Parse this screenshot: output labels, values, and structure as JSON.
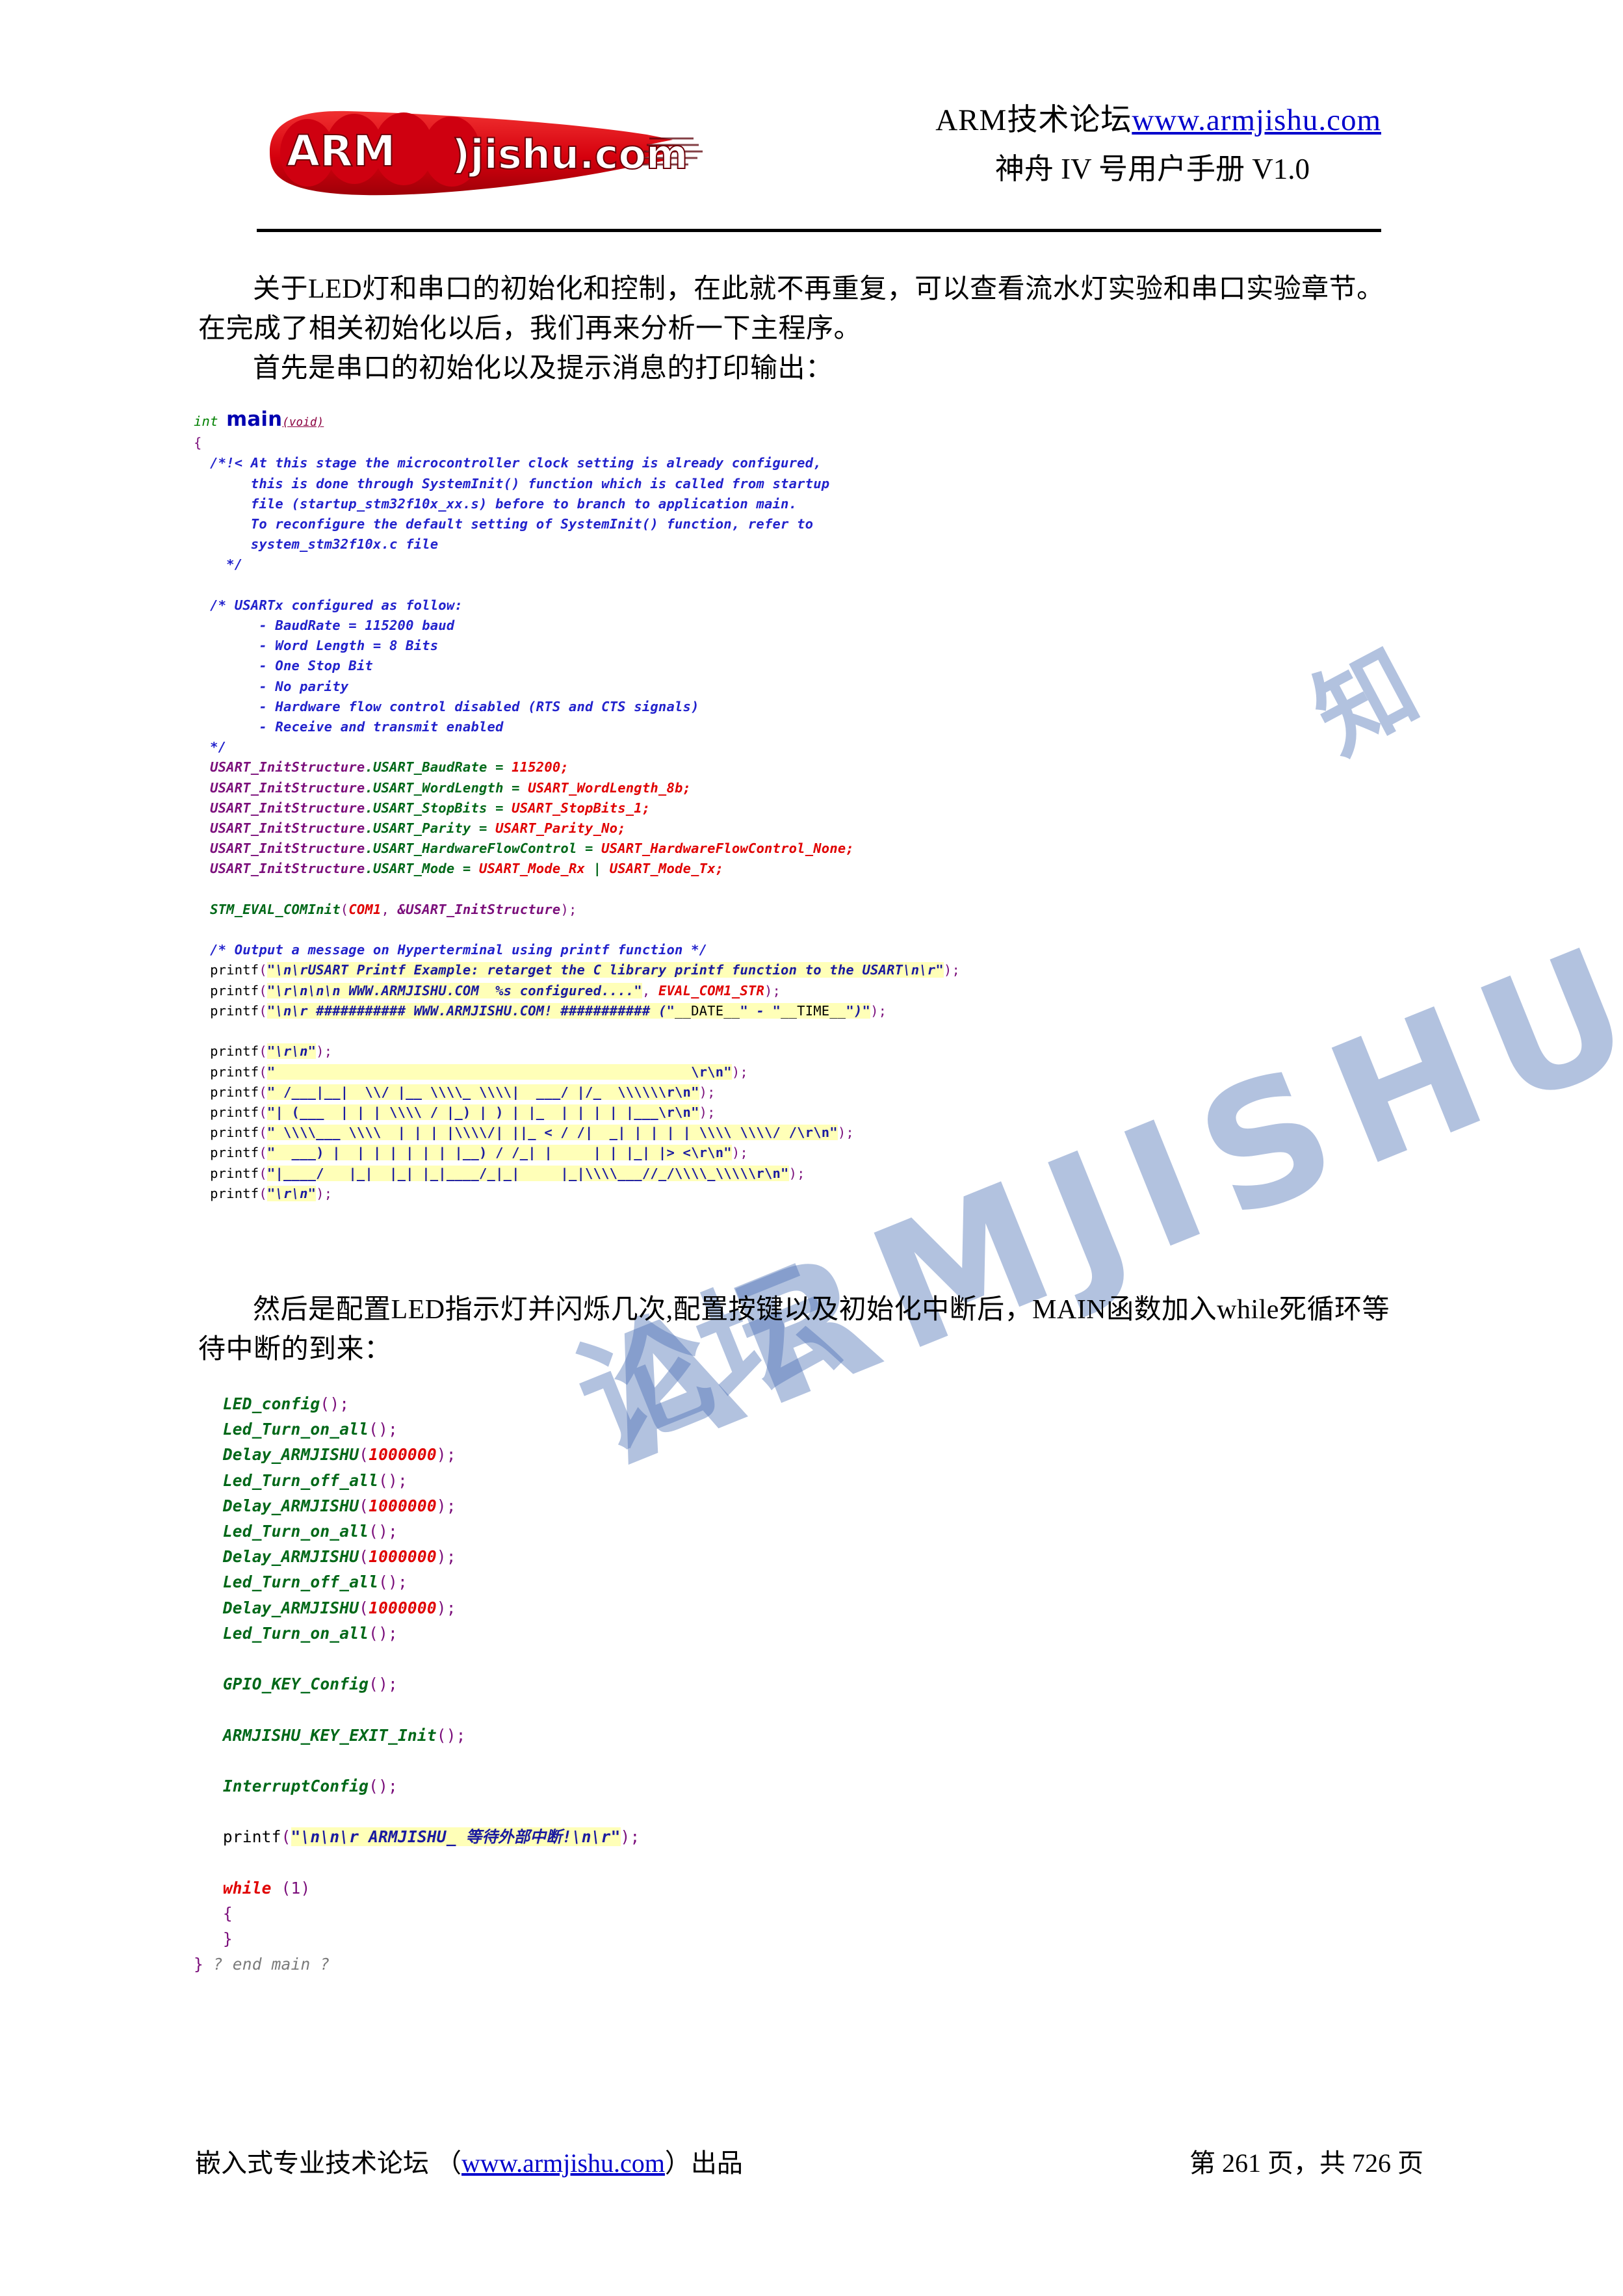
{
  "header": {
    "logo_alt": "ARMjishu.com",
    "logo_text_main": "ARM",
    "logo_text_sub": "jishu.com",
    "line1_cn": "ARM技术论坛",
    "line1_url": "www.armjishu.com",
    "line2": "神舟 IV 号用户手册 V1.0"
  },
  "paragraphs": {
    "p1": "关于LED灯和串口的初始化和控制，在此就不再重复，可以查看流水灯实验和串口实验章节。在完成了相关初始化以后，我们再来分析一下主程序。",
    "p1b": "首先是串口的初始化以及提示消息的打印输出：",
    "p2": "然后是配置LED指示灯并闪烁几次,配置按键以及初始化中断后，MAIN函数加入while死循环等待中断的到来："
  },
  "code1": {
    "signature_type": "int",
    "signature_name": "main",
    "signature_params": "(void)",
    "open_brace": "{",
    "comment1": [
      "/*!< At this stage the microcontroller clock setting is already configured,",
      "     this is done through SystemInit() function which is called from startup",
      "     file (startup_stm32f10x_xx.s) before to branch to application main.",
      "     To reconfigure the default setting of SystemInit() function, refer to",
      "     system_stm32f10x.c file",
      "  */"
    ],
    "comment2": [
      "/* USARTx configured as follow:",
      "      - BaudRate = 115200 baud",
      "      - Word Length = 8 Bits",
      "      - One Stop Bit",
      "      - No parity",
      "      - Hardware flow control disabled (RTS and CTS signals)",
      "      - Receive and transmit enabled",
      "*/"
    ],
    "init_lines": [
      {
        "obj": "USART_InitStructure",
        "member": ".USART_BaudRate",
        "op": " = ",
        "value": "115200",
        "end": ";"
      },
      {
        "obj": "USART_InitStructure",
        "member": ".USART_WordLength",
        "op": " = ",
        "value": "USART_WordLength_8b",
        "end": ";"
      },
      {
        "obj": "USART_InitStructure",
        "member": ".USART_StopBits",
        "op": " = ",
        "value": "USART_StopBits_1",
        "end": ";"
      },
      {
        "obj": "USART_InitStructure",
        "member": ".USART_Parity",
        "op": " = ",
        "value": "USART_Parity_No",
        "end": ";"
      },
      {
        "obj": "USART_InitStructure",
        "member": ".USART_HardwareFlowControl",
        "op": " = ",
        "value": "USART_HardwareFlowControl_None",
        "end": ";"
      },
      {
        "obj": "USART_InitStructure",
        "member": ".USART_Mode",
        "op": " = ",
        "value": "USART_Mode_Rx | USART_Mode_Tx",
        "end": ";"
      }
    ],
    "cominit_func": "STM_EVAL_COMInit",
    "cominit_arg1": "COM1",
    "cominit_arg2": "&USART_InitStructure",
    "comment3": "/* Output a message on Hyperterminal using printf function */",
    "printf_lines": [
      {
        "str": "\"\\n\\rUSART Printf Example: retarget the C library printf function to the USART\\n\\r\"",
        "arg": "",
        "tail": ");"
      },
      {
        "str": "\"\\r\\n\\n\\n WWW.ARMJISHU.COM  %s configured....\"",
        "arg": "EVAL_COM1_STR",
        "tail": ");"
      },
      {
        "str": "\"\\n\\r ########### WWW.ARMJISHU.COM! ########### (\"__DATE__\" - \"__TIME__\")\"",
        "arg": "",
        "tail": ");"
      }
    ],
    "ascii_art": [
      "printf(\"\\r\\n\");",
      "printf(\"                                                  \\r\\n\");",
      "printf(\" /___|__|  \\\\/ |__ \\\\\\\\_ \\\\\\\\| ___/ |/_ \\\\\\\\\\\\r\\n\");",
      "printf(\"| (___ | | | \\\\\\\\ / |_) | ) | |_  | | | | |__ \\\\r\\n\");",
      "printf(\" \\\\\\\\___ \\\\\\\\  | | | |\\\\\\\\/| ||_ < / /| _| | | | | \\\\\\\\ \\\\\\\\/ /\\\\r\\n\");",
      "printf(\"  ___) | | | | | | | |__) / /_| |   | | |_| |> < \\\\r\\n\");",
      "printf(\"|____/  |_| |_| |_|____/_|_|   |_|\\\\\\\\___//_/\\\\\\\\_\\\\\\\\\\\\r\\n\");",
      "printf(\"\\r\\n\");"
    ]
  },
  "code2": {
    "lines": [
      {
        "func": "LED_config",
        "args": "",
        "type": "call"
      },
      {
        "func": "Led_Turn_on_all",
        "args": "",
        "type": "call"
      },
      {
        "func": "Delay_ARMJISHU",
        "args": "1000000",
        "type": "call"
      },
      {
        "func": "Led_Turn_off_all",
        "args": "",
        "type": "call"
      },
      {
        "func": "Delay_ARMJISHU",
        "args": "1000000",
        "type": "call"
      },
      {
        "func": "Led_Turn_on_all",
        "args": "",
        "type": "call"
      },
      {
        "func": "Delay_ARMJISHU",
        "args": "1000000",
        "type": "call"
      },
      {
        "func": "Led_Turn_off_all",
        "args": "",
        "type": "call"
      },
      {
        "func": "Delay_ARMJISHU",
        "args": "1000000",
        "type": "call"
      },
      {
        "func": "Led_Turn_on_all",
        "args": "",
        "type": "call"
      },
      {
        "type": "blank"
      },
      {
        "func": "GPIO_KEY_Config",
        "args": "",
        "type": "call"
      },
      {
        "type": "blank"
      },
      {
        "func": "ARMJISHU_KEY_EXIT_Init",
        "args": "",
        "type": "call"
      },
      {
        "type": "blank"
      },
      {
        "func": "InterruptConfig",
        "args": "",
        "type": "call"
      },
      {
        "type": "blank"
      },
      {
        "type": "printf",
        "func": "printf",
        "str": "\"\\n\\n\\r ARMJISHU_ 等待外部中断!\\n\\r\""
      },
      {
        "type": "blank"
      },
      {
        "type": "keyword",
        "kw": "while",
        "args": "(1)"
      },
      {
        "type": "brace",
        "text": "  {"
      },
      {
        "type": "brace",
        "text": "  }"
      }
    ],
    "end_brace": "}",
    "end_comment": "? end main ?"
  },
  "watermarks": {
    "wm1": "知",
    "wm2": "ARMJISHU",
    "wm3": "论坛"
  },
  "footer": {
    "left_pre": "嵌入式专业技术论坛 （",
    "left_url": "www.armjishu.com",
    "left_post": "）出品",
    "right": "第 261 页，共 726 页"
  },
  "colors": {
    "link": "#0000cc",
    "comment": "#2222cc",
    "identifier": "#7b0f7b",
    "member": "#006818",
    "value": "#e00000",
    "highlight": "#ffffb8",
    "logo_red": "#d8000c"
  }
}
